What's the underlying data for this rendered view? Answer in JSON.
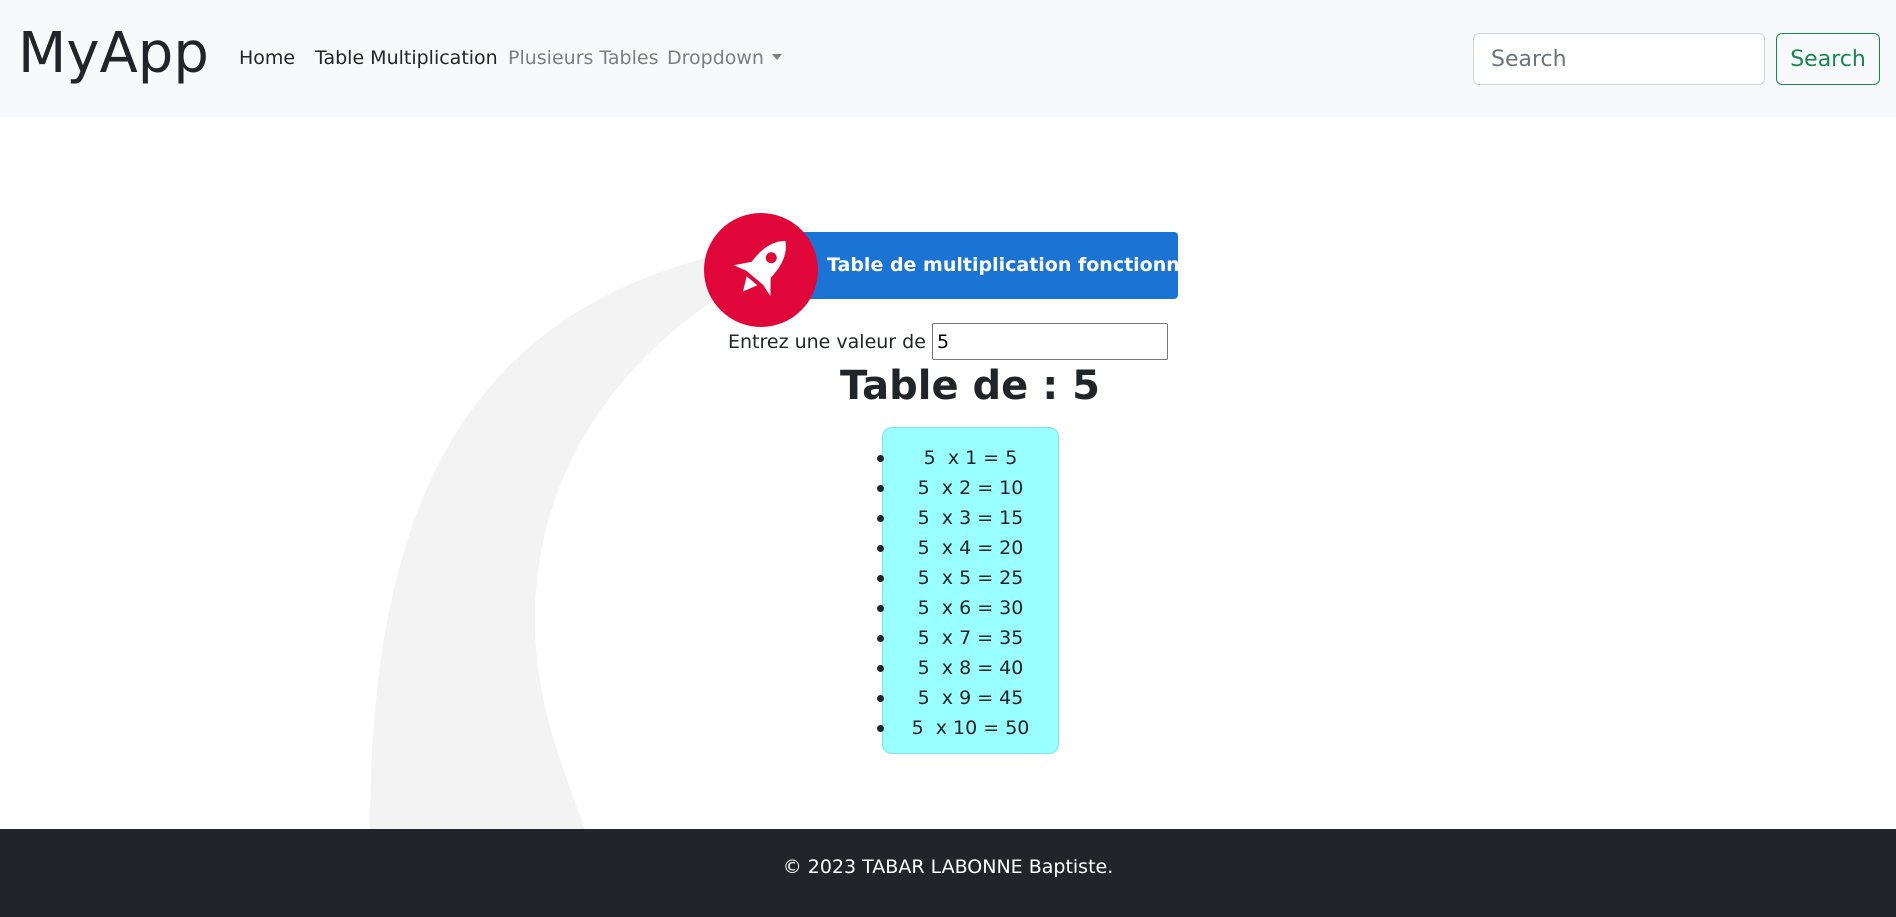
{
  "navbar": {
    "brand": "MyApp",
    "links": [
      {
        "label": "Home"
      },
      {
        "label": "Table Multiplication"
      },
      {
        "label": "Plusieurs Tables"
      },
      {
        "label": "Dropdown"
      }
    ],
    "search": {
      "placeholder": "Search",
      "button_label": "Search"
    }
  },
  "main": {
    "hero_button_label": "Table de multiplication fonctionnelle",
    "rocket_icon": "rocket-icon",
    "n_label": "Entrez une valeur de n :",
    "n_value": "5",
    "table_title": "Table de : 5",
    "rows": [
      "5  x 1 = 5",
      "5  x 2 = 10",
      "5  x 3 = 15",
      "5  x 4 = 20",
      "5  x 5 = 25",
      "5  x 6 = 30",
      "5  x 7 = 35",
      "5  x 8 = 40",
      "5  x 9 = 45",
      "5  x 10 = 50"
    ]
  },
  "footer": {
    "text": "© 2023 TABAR LABONNE Baptiste."
  },
  "colors": {
    "navbar_bg": "#f8f9fa",
    "hero_blue": "#1b74d4",
    "rocket_red": "#e0063a",
    "table_bg": "#99ffff",
    "search_green": "#198754",
    "footer_bg": "#212529"
  }
}
